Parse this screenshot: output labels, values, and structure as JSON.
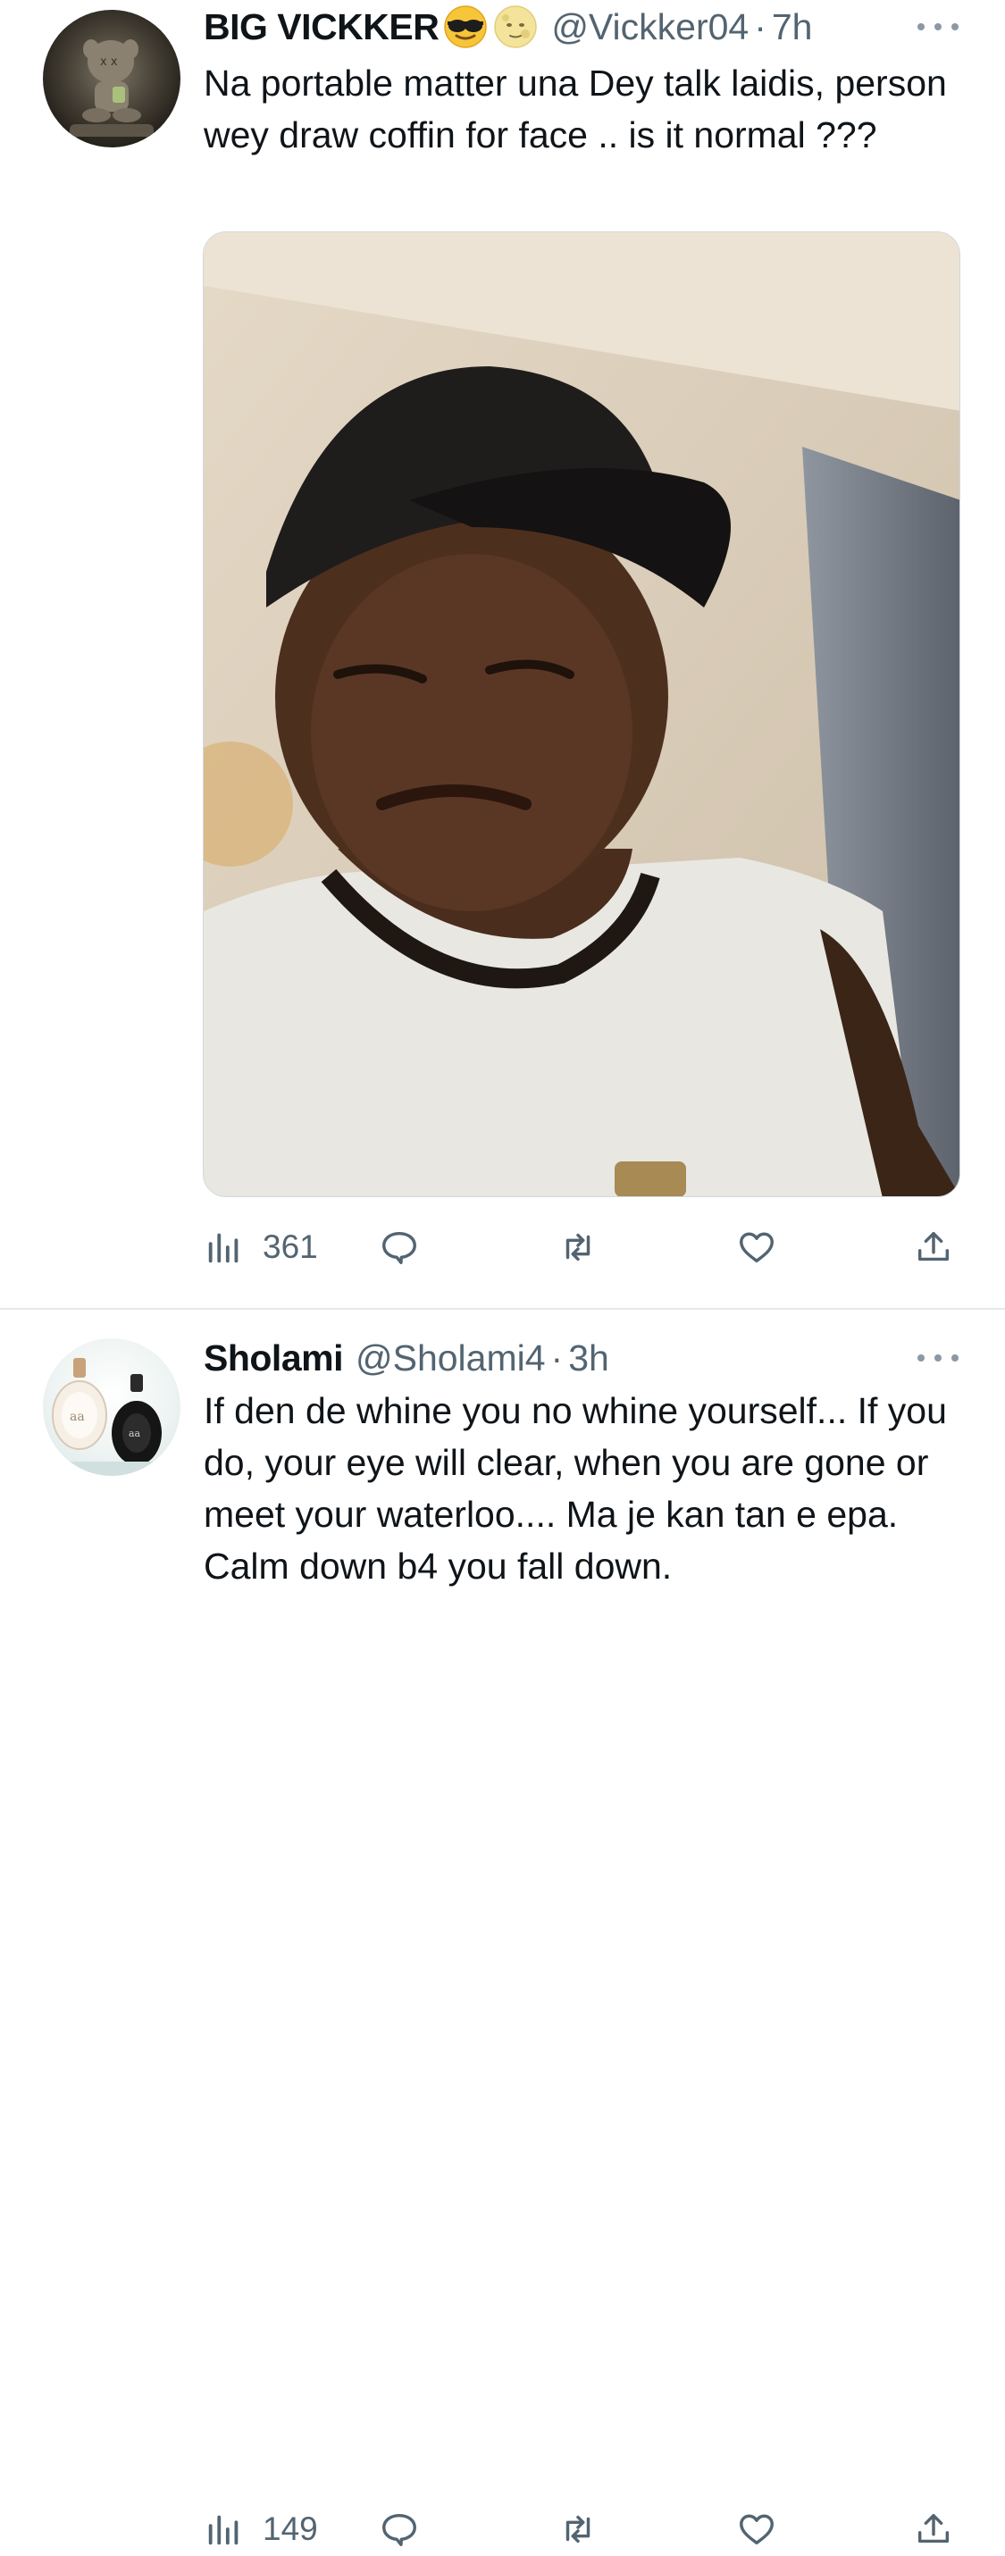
{
  "tweets": [
    {
      "author_name": "BIG VICKKER",
      "emojis": [
        "smiling-face-with-sunglasses",
        "full-moon-face"
      ],
      "handle": "@Vickker04",
      "separator": "·",
      "time": "7h",
      "text": "Na portable matter una Dey talk laidis, person wey draw coffin for face .. is it normal ???",
      "has_media": true,
      "media_icon": "photo-man-in-black-cap",
      "views": "361"
    },
    {
      "author_name": "Sholami",
      "handle": "@Sholami4",
      "separator": "·",
      "time": "3h",
      "text": "If den de whine you no whine yourself... If you do, your eye will clear, when you are gone or meet your waterloo.... Ma je kan tan e epa. Calm down b4 you fall down.",
      "has_media": false,
      "avatar_marks": [
        "aa",
        "aa"
      ],
      "views": "149"
    }
  ],
  "colors": {
    "text_primary": "#0f1419",
    "text_secondary": "#536471",
    "divider": "#e6e9ec"
  }
}
